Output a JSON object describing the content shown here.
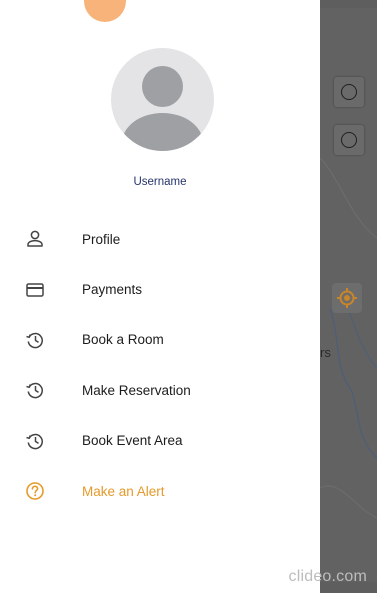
{
  "profile": {
    "username": "Username"
  },
  "menu": {
    "items": [
      {
        "label": "Profile",
        "icon": "person-icon"
      },
      {
        "label": "Payments",
        "icon": "credit-card-icon"
      },
      {
        "label": "Book a Room",
        "icon": "history-icon"
      },
      {
        "label": "Make Reservation",
        "icon": "history-icon"
      },
      {
        "label": "Book Event Area",
        "icon": "history-icon"
      },
      {
        "label": "Make an Alert",
        "icon": "help-circle-icon"
      }
    ]
  },
  "map": {
    "partial_label": "rs"
  },
  "watermark": "clideo.com",
  "colors": {
    "accent": "#e59a2a",
    "username": "#27346b",
    "avatar_bg": "#e4e4e6",
    "avatar_fg": "#9ea0a4",
    "bubble": "#f8b37a",
    "scrim": "#626262"
  }
}
